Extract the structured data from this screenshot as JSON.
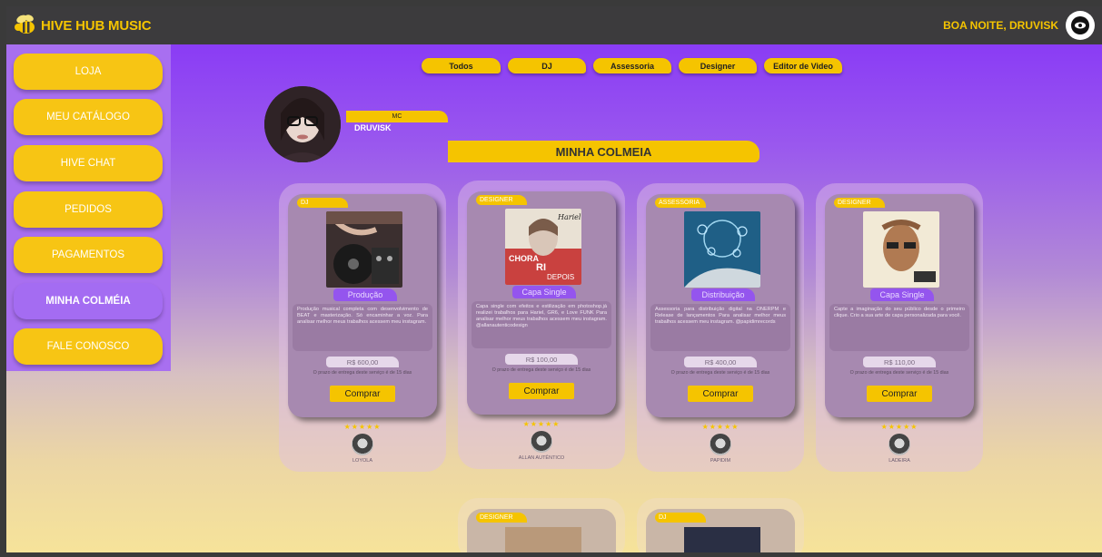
{
  "header": {
    "brand": "HIVE HUB MUSIC",
    "greeting": "BOA NOITE, DRUVISK"
  },
  "sidebar": {
    "items": [
      {
        "label": "LOJA"
      },
      {
        "label": "MEU CATÁLOGO"
      },
      {
        "label": "HIVE CHAT"
      },
      {
        "label": "PEDIDOS"
      },
      {
        "label": "PAGAMENTOS"
      },
      {
        "label": "MINHA COLMÉIA",
        "active": true
      },
      {
        "label": "FALE CONOSCO"
      }
    ]
  },
  "filters": [
    "Todos",
    "DJ",
    "Assessoria",
    "Designer",
    "Editor de Video"
  ],
  "profile": {
    "role": "MC",
    "name": "DRUVISK"
  },
  "section_title": "MINHA COLMEIA",
  "cards": [
    {
      "category": "DJ",
      "service": "Produção",
      "description": "Produção musical completa com desenvolvimento de BEAT e masterização. Só encaminhar a voz. Para analisar melhor meus trabalhos acessem meu instagram.",
      "price": "R$ 600,00",
      "delivery": "O prazo de entrega deste serviço é de 15 dias",
      "buy_label": "Comprar",
      "stars": "★★★★★",
      "seller": "LOYOLA"
    },
    {
      "category": "DESIGNER",
      "service": "Capa Single",
      "description": "Capa single com efeitos e estilização em photoshop.já realizei trabalhos para Hariel, GR6, e Love FUNK Para analisar melhor meus trabalhos acessem meu instagram. @allanautenticodesign",
      "price": "R$ 100,00",
      "delivery": "O prazo de entrega deste serviço é de 15 dias",
      "buy_label": "Comprar",
      "stars": "★★★★★",
      "seller": "ALLAN AUTÊNTICO"
    },
    {
      "category": "ASSESSORIA",
      "service": "Distribuição",
      "description": "Assessoria para distribuição digital na ONERPM e Release de lançamentos Para analisar melhor meus trabalhos acessem meu instagram. @papidimrecords",
      "price": "R$ 400,00",
      "delivery": "O prazo de entrega deste serviço é de 15 dias",
      "buy_label": "Comprar",
      "stars": "★★★★★",
      "seller": "PAPIDIM"
    },
    {
      "category": "DESIGNER",
      "service": "Capa Single",
      "description": "Capte a imaginação do seu público desde o primeiro clique. Crio a sua arte de capa personalizada para você.",
      "price": "R$ 110,00",
      "delivery": "O prazo de entrega deste serviço é de 15 dias",
      "buy_label": "Comprar",
      "stars": "★★★★★",
      "seller": "LADEIRA"
    }
  ],
  "lower_cards": [
    {
      "category": "DESIGNER"
    },
    {
      "category": "DJ"
    }
  ],
  "thumb_art": {
    "card2_text1": "Hariel",
    "card2_text2": "CHORA",
    "card2_text3": "RI",
    "card2_text4": "DEPOIS"
  }
}
